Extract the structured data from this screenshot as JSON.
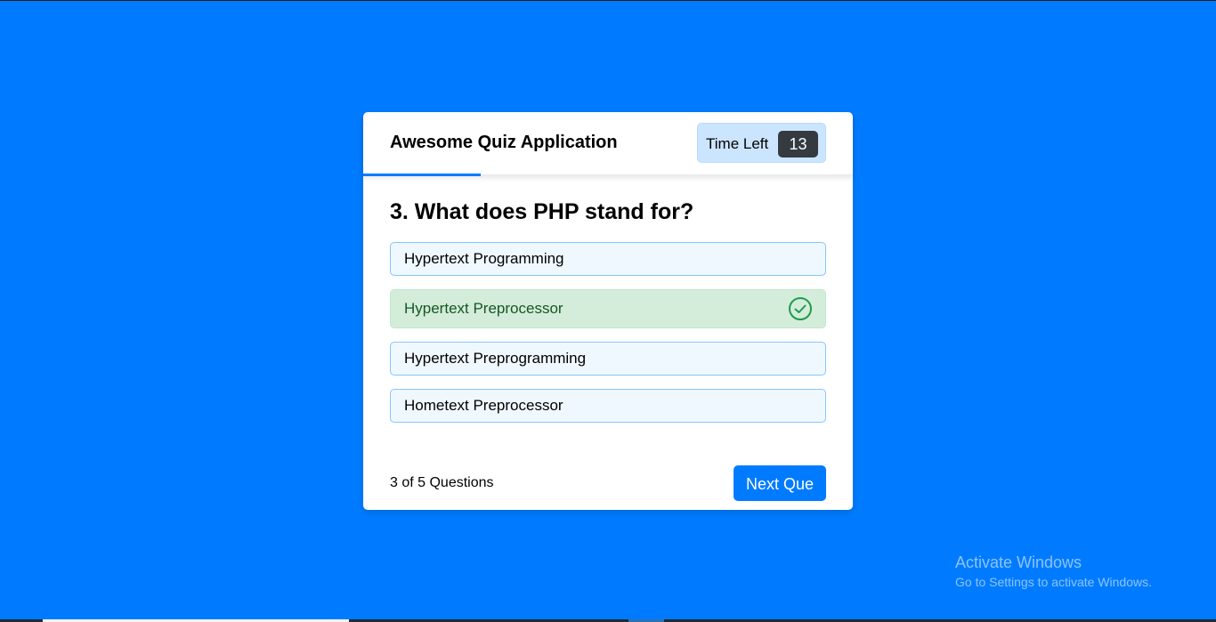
{
  "colors": {
    "page_background": "#007bff",
    "accent": "#007bff",
    "correct_background": "#d4edda",
    "correct_text": "#155724",
    "option_background": "#f0f8ff",
    "timer_background": "#cce5ff",
    "timer_seconds_background": "#343a40"
  },
  "header": {
    "title": "Awesome Quiz Application",
    "timer": {
      "label": "Time Left",
      "seconds": "13"
    },
    "time_line_progress": 0.24
  },
  "question": {
    "text": "3. What does PHP stand for?",
    "options": [
      {
        "label": "Hypertext Programming",
        "state": "default"
      },
      {
        "label": "Hypertext Preprocessor",
        "state": "correct",
        "icon": "check-circle-icon"
      },
      {
        "label": "Hypertext Preprogramming",
        "state": "default"
      },
      {
        "label": "Hometext Preprocessor",
        "state": "default"
      }
    ]
  },
  "footer": {
    "progress_text": "3 of 5 Questions",
    "next_button": "Next Que"
  },
  "watermark": {
    "title": "Activate Windows",
    "subtitle": "Go to Settings to activate Windows."
  }
}
